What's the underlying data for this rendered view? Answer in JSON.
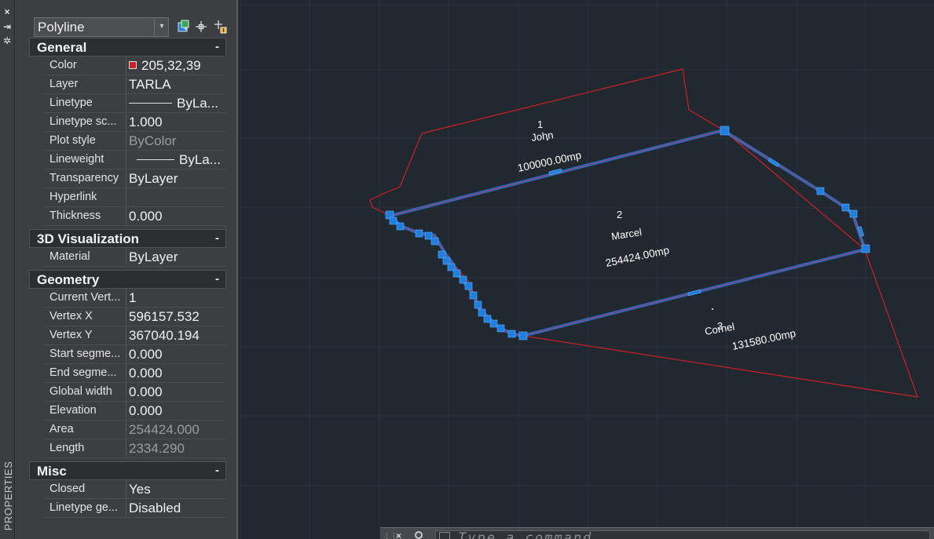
{
  "palette": {
    "panel_text": "#e4e4e4",
    "canvas_bg": "#212830",
    "boundary_red": "#cd2027",
    "selection_blue": "#1e7fe0",
    "grid": "#2b323c",
    "label_white": "#ffffff"
  },
  "strip": {
    "close_icon": "×",
    "pin_icon": "⇥",
    "settings_icon": "✲",
    "label": "PROPERTIES"
  },
  "panel": {
    "object_type": "Polyline",
    "toolbar_icons": [
      "toggle-pickadd-icon",
      "select-objects-icon",
      "quick-select-icon"
    ],
    "sections": {
      "general": {
        "title": "General",
        "collapse": "-",
        "rows": [
          {
            "label": "Color",
            "value": "205,32,39"
          },
          {
            "label": "Layer",
            "value": "TARLA"
          },
          {
            "label": "Linetype",
            "value": "ByLa..."
          },
          {
            "label": "Linetype sc...",
            "value": "1.000"
          },
          {
            "label": "Plot style",
            "value": "ByColor"
          },
          {
            "label": "Lineweight",
            "value": "ByLa..."
          },
          {
            "label": "Transparency",
            "value": "ByLayer"
          },
          {
            "label": "Hyperlink",
            "value": ""
          },
          {
            "label": "Thickness",
            "value": "0.000"
          }
        ]
      },
      "viz3d": {
        "title": "3D Visualization",
        "collapse": "-",
        "rows": [
          {
            "label": "Material",
            "value": "ByLayer"
          }
        ]
      },
      "geometry": {
        "title": "Geometry",
        "collapse": "-",
        "rows": [
          {
            "label": "Current Vert...",
            "value": "1"
          },
          {
            "label": "Vertex X",
            "value": "596157.532"
          },
          {
            "label": "Vertex Y",
            "value": "367040.194"
          },
          {
            "label": "Start segme...",
            "value": "0.000"
          },
          {
            "label": "End segme...",
            "value": "0.000"
          },
          {
            "label": "Global width",
            "value": "0.000"
          },
          {
            "label": "Elevation",
            "value": "0.000"
          },
          {
            "label": "Area",
            "value": "254424.000"
          },
          {
            "label": "Length",
            "value": "2334.290"
          }
        ]
      },
      "misc": {
        "title": "Misc",
        "collapse": "-",
        "rows": [
          {
            "label": "Closed",
            "value": "Yes"
          },
          {
            "label": "Linetype ge...",
            "value": "Disabled"
          }
        ]
      }
    }
  },
  "drawing": {
    "parcels": [
      {
        "number": "1",
        "owner": "John",
        "area": "100000.00mp"
      },
      {
        "number": "2",
        "owner": "Marcel",
        "area": "254424.00mp"
      },
      {
        "number": "3",
        "owner": "Cornel",
        "area": "131580.00mp"
      }
    ]
  },
  "command_line": {
    "close_icon": "×",
    "customize_icon": "wrench-icon",
    "placeholder": "Type a command"
  }
}
